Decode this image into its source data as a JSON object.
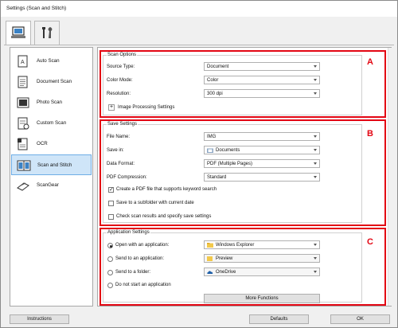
{
  "window": {
    "title": "Settings (Scan and Stitch)"
  },
  "tabs": [
    {
      "icon": "computer-icon"
    },
    {
      "icon": "tools-icon"
    }
  ],
  "sidebar": {
    "items": [
      {
        "label": "Auto Scan",
        "icon": "auto-scan-icon"
      },
      {
        "label": "Document Scan",
        "icon": "document-scan-icon"
      },
      {
        "label": "Photo Scan",
        "icon": "photo-scan-icon"
      },
      {
        "label": "Custom Scan",
        "icon": "custom-scan-icon"
      },
      {
        "label": "OCR",
        "icon": "ocr-icon"
      },
      {
        "label": "Scan and Stitch",
        "icon": "scan-stitch-icon",
        "selected": true
      },
      {
        "label": "ScanGear",
        "icon": "scangear-icon"
      }
    ]
  },
  "markers": {
    "a": "A",
    "b": "B",
    "c": "C"
  },
  "scan_options": {
    "title": "Scan Options",
    "source_type": {
      "label": "Source Type:",
      "value": "Document"
    },
    "color_mode": {
      "label": "Color Mode:",
      "value": "Color"
    },
    "resolution": {
      "label": "Resolution:",
      "value": "300 dpi"
    },
    "image_processing": {
      "expander": "+",
      "label": "Image Processing Settings"
    }
  },
  "save_settings": {
    "title": "Save Settings",
    "file_name": {
      "label": "File Name:",
      "value": "IMG"
    },
    "save_in": {
      "label": "Save in:",
      "value": "Documents"
    },
    "data_format": {
      "label": "Data Format:",
      "value": "PDF (Multiple Pages)"
    },
    "pdf_compression": {
      "label": "PDF Compression:",
      "value": "Standard"
    },
    "checks": [
      {
        "label": "Create a PDF file that supports keyword search",
        "checked": true
      },
      {
        "label": "Save to a subfolder with current date",
        "checked": false
      },
      {
        "label": "Check scan results and specify save settings",
        "checked": false
      }
    ]
  },
  "application_settings": {
    "title": "Application Settings",
    "open_with": {
      "label": "Open with an application:",
      "value": "Windows Explorer",
      "selected": true
    },
    "send_to_app": {
      "label": "Send to an application:",
      "value": "Preview"
    },
    "send_to_folder": {
      "label": "Send to a folder:",
      "value": "OneDrive"
    },
    "no_app": {
      "label": "Do not start an application"
    },
    "more_functions": "More Functions"
  },
  "footer": {
    "instructions": "Instructions",
    "defaults": "Defaults",
    "ok": "OK"
  },
  "colors": {
    "accent_red": "#e30613",
    "selection": "#cfe5f8"
  }
}
